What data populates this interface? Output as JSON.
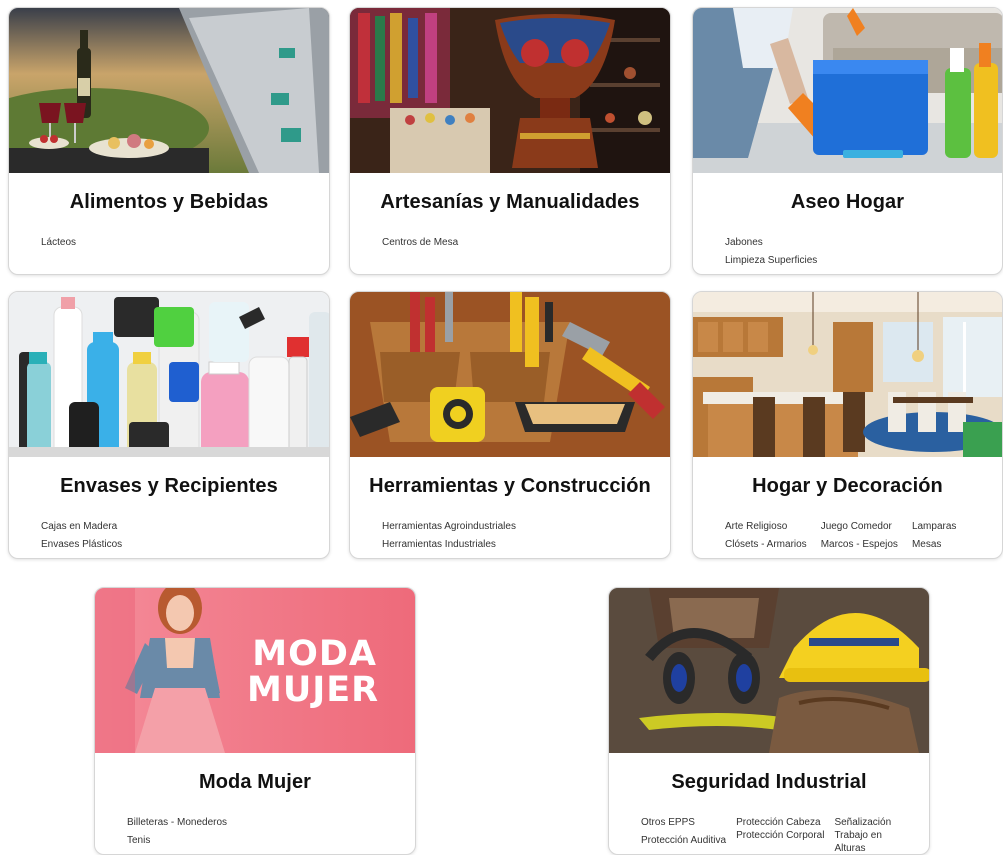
{
  "categories": [
    {
      "title": "Alimentos y Bebidas",
      "items": [
        "Lácteos"
      ]
    },
    {
      "title": "Artesanías y Manualidades",
      "items": [
        "Centros de Mesa"
      ]
    },
    {
      "title": "Aseo Hogar",
      "items": [
        "Jabones",
        "Limpieza Superficies"
      ]
    },
    {
      "title": "Envases y Recipientes",
      "items": [
        "Cajas en Madera",
        "Envases Plásticos"
      ]
    },
    {
      "title": "Herramientas y Construcción",
      "items": [
        "Herramientas Agroindustriales",
        "Herramientas Industriales"
      ]
    },
    {
      "title": "Hogar y Decoración",
      "items": [
        "Arte Religioso",
        "Clósets - Armarios",
        "Juego Comedor",
        "Marcos - Espejos",
        "Lamparas",
        "Mesas"
      ]
    },
    {
      "title": "Moda Mujer",
      "banner": "MODA MUJER",
      "items": [
        "Billeteras - Monederos",
        "Tenis"
      ]
    },
    {
      "title": "Seguridad Industrial",
      "items": [
        "Otros EPPS",
        "Protección Auditiva",
        "Protección Cabeza",
        "Protección Corporal",
        "Señalización",
        "Trabajo en Alturas"
      ]
    }
  ]
}
